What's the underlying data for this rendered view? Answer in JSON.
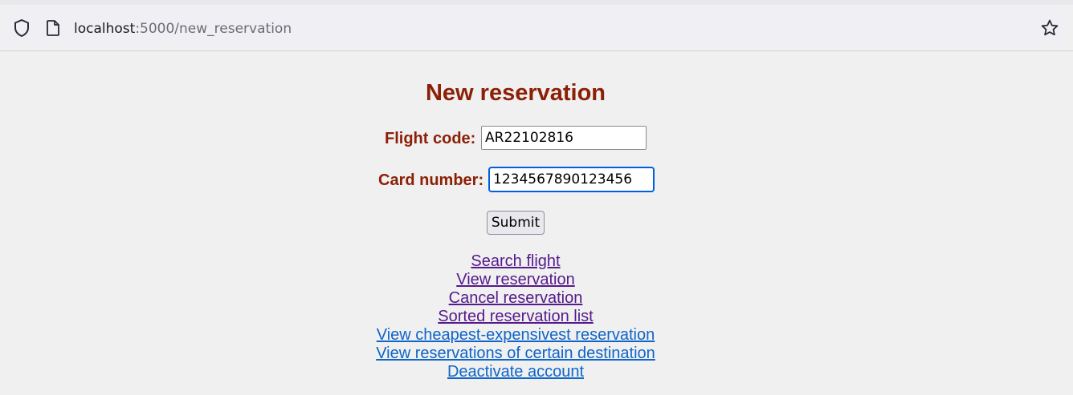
{
  "browser": {
    "url_host": "localhost",
    "url_rest": ":5000/new_reservation"
  },
  "page": {
    "title": "New reservation"
  },
  "form": {
    "flight_code_label": "Flight code:",
    "flight_code_value": "AR22102816",
    "card_number_label": "Card number:",
    "card_number_value": "1234567890123456",
    "submit_label": "Submit"
  },
  "links": [
    {
      "label": "Search flight",
      "visited": true
    },
    {
      "label": "View reservation",
      "visited": true
    },
    {
      "label": "Cancel reservation",
      "visited": true
    },
    {
      "label": "Sorted reservation list",
      "visited": true
    },
    {
      "label": "View cheapest-expensivest reservation",
      "visited": false
    },
    {
      "label": "View reservations of certain destination",
      "visited": false
    },
    {
      "label": "Deactivate account",
      "visited": false
    }
  ],
  "colors": {
    "heading": "#8b2006",
    "visited_link": "#551a8b",
    "link": "#0f65c8",
    "focus_ring": "#0060df"
  }
}
